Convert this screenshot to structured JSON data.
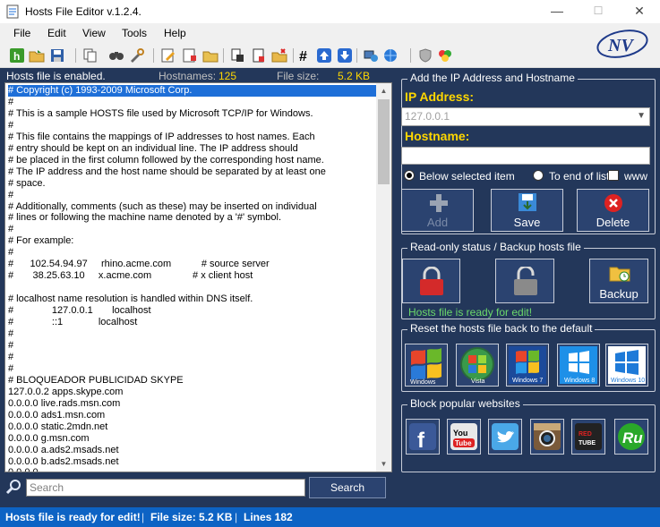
{
  "window": {
    "title": "Hosts File Editor v.1.2.4.",
    "minimize": "—",
    "maximize": "☐",
    "close": "✕"
  },
  "menu": [
    "File",
    "Edit",
    "View",
    "Tools",
    "Help"
  ],
  "toolbar_icons": [
    "hosts-icon",
    "open-folder-icon",
    "save-icon",
    "copy-icon",
    "find-icon",
    "tools-icon",
    "edit-icon",
    "add-icon",
    "folder-icon",
    "cut-icon",
    "paste-icon",
    "delete-icon",
    "hash-icon",
    "move-up-icon",
    "move-down-icon",
    "network-icon",
    "web-icon",
    "shield-icon",
    "color-icon"
  ],
  "info": {
    "status": "Hosts file is enabled.",
    "hostnames_label": "Hostnames:",
    "hostnames_value": "125",
    "filesize_label": "File size:",
    "filesize_value": "5.2 KB"
  },
  "editor_lines": [
    "# Copyright (c) 1993-2009 Microsoft Corp.",
    "#",
    "# This is a sample HOSTS file used by Microsoft TCP/IP for Windows.",
    "#",
    "# This file contains the mappings of IP addresses to host names. Each",
    "# entry should be kept on an individual line. The IP address should",
    "# be placed in the first column followed by the corresponding host name.",
    "# The IP address and the host name should be separated by at least one",
    "# space.",
    "#",
    "# Additionally, comments (such as these) may be inserted on individual",
    "# lines or following the machine name denoted by a '#' symbol.",
    "#",
    "# For example:",
    "#",
    "#      102.54.94.97     rhino.acme.com           # source server",
    "#       38.25.63.10     x.acme.com               # x client host",
    "",
    "# localhost name resolution is handled within DNS itself.",
    "#              127.0.0.1       localhost",
    "#              ::1             localhost",
    "#",
    "#",
    "#",
    "#",
    "# BLOQUEADOR PUBLICIDAD SKYPE",
    "127.0.0.2 apps.skype.com",
    "0.0.0.0 live.rads.msn.com",
    "0.0.0.0 ads1.msn.com",
    "0.0.0.0 static.2mdn.net",
    "0.0.0.0 g.msn.com",
    "0.0.0.0 a.ads2.msads.net",
    "0.0.0.0 b.ads2.msads.net",
    "0.0.0.0 ..."
  ],
  "search": {
    "placeholder": "Search",
    "button": "Search"
  },
  "add_panel": {
    "title": "Add the IP Address  and Hostname",
    "ip_label": "IP Address:",
    "ip_value": "127.0.0.1",
    "hostname_label": "Hostname:",
    "hostname_value": "",
    "radio_below": "Below selected item",
    "radio_end": "To end of list",
    "www_label": "www",
    "add_button": "Add",
    "save_button": "Save",
    "delete_button": "Delete"
  },
  "readonly_panel": {
    "title": "Read-only status / Backup hosts file",
    "backup_button": "Backup",
    "status_message": "Hosts file is ready for edit!"
  },
  "reset_panel": {
    "title": "Reset the hosts file back to the default",
    "os": [
      "Windows XP",
      "Windows Vista",
      "Windows 7",
      "Windows 8",
      "Windows 10"
    ],
    "labels": [
      "Windows",
      "Vista",
      "Windows 7",
      "Windows 8",
      "Windows 10"
    ]
  },
  "block_panel": {
    "title": "Block popular websites",
    "sites": [
      "Facebook",
      "YouTube",
      "Twitter",
      "Instagram",
      "RedTube",
      "Ru"
    ]
  },
  "statusbar": {
    "message": "Hosts file is ready for edit!",
    "filesize": "File size:  5.2 KB",
    "lines": "Lines 182",
    "separator": "|"
  },
  "colors": {
    "panel_bg": "#23375a",
    "button_bg": "#2b4370",
    "accent_yellow": "#ffd700",
    "status_green": "#6bd86b",
    "status_blue": "#0d63c4"
  }
}
